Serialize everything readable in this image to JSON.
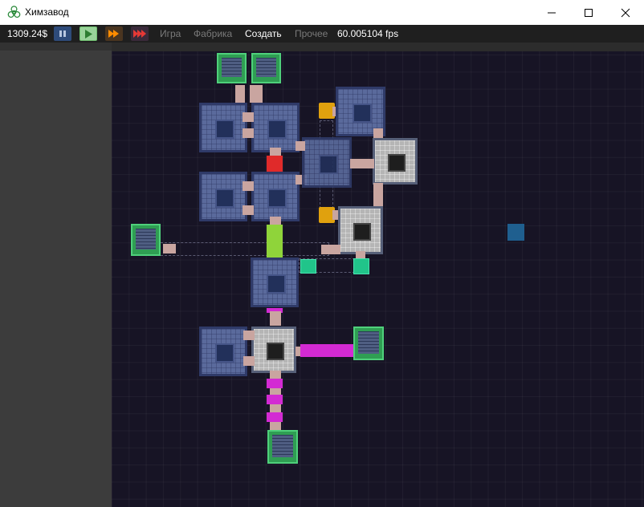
{
  "window": {
    "title": "Химзавод",
    "app_icon": "biohazard-icon",
    "controls": [
      "minimize-icon",
      "maximize-icon",
      "close-icon"
    ]
  },
  "toolbar": {
    "money": "1309.24$",
    "buttons": [
      {
        "name": "pause-button",
        "icon": "pause-icon",
        "color": "#2e4b7a"
      },
      {
        "name": "play-button",
        "icon": "play-icon",
        "color": "#4caf50"
      },
      {
        "name": "fast-forward-button",
        "icon": "fast-forward-icon",
        "color": "#ff8c00"
      },
      {
        "name": "fastest-button",
        "icon": "fastest-forward-icon",
        "color": "#e53935"
      }
    ],
    "menu": [
      {
        "label": "Игра",
        "state": "disabled"
      },
      {
        "label": "Фабрика",
        "state": "disabled"
      },
      {
        "label": "Создать",
        "state": "active"
      },
      {
        "label": "Прочее",
        "state": "disabled"
      }
    ],
    "fps": "60.005104 fps"
  },
  "colors": {
    "background": "#171425",
    "reactor": "#5a6a9c",
    "mixer": "#b5b5b5",
    "crate": "#2f9e53",
    "fluid_red": "#e02a2a",
    "fluid_lime": "#8fd43a",
    "fluid_magenta": "#d32ad3",
    "fluid_teal": "#21c48a",
    "fluid_yellow": "#e0a10e",
    "highlight_tile": "#1f5f8f"
  }
}
